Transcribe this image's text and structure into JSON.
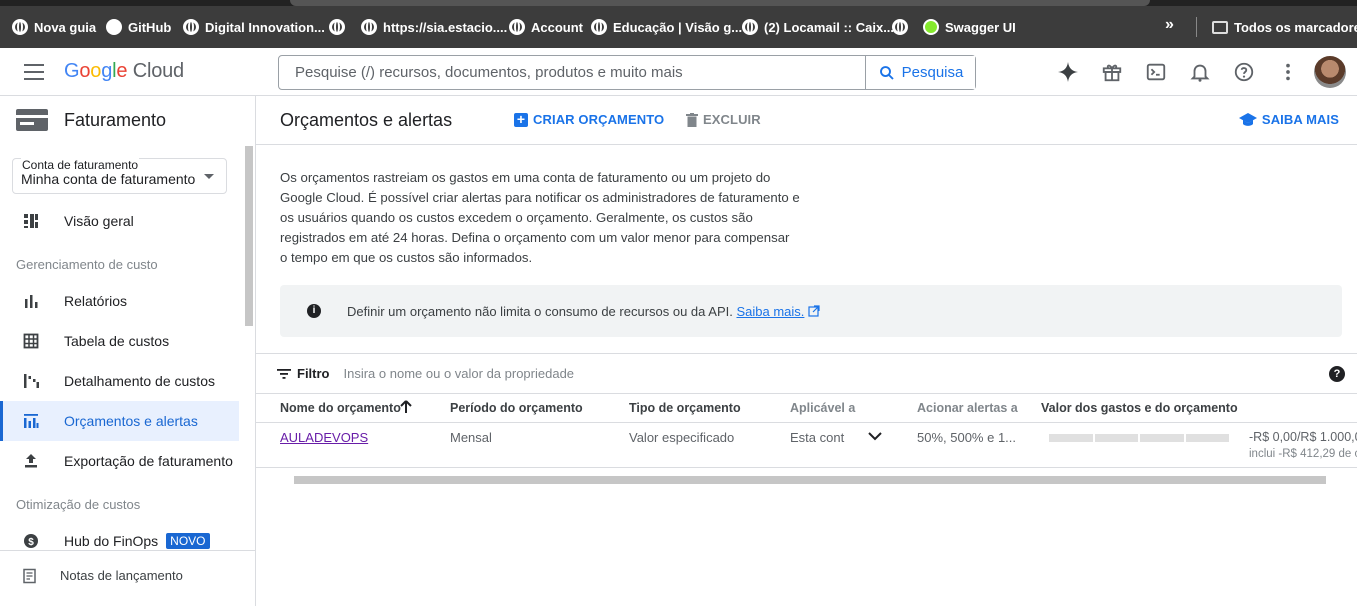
{
  "bookmarks": {
    "items": [
      {
        "label": "Nova guia",
        "icon": "globe-icon"
      },
      {
        "label": "GitHub",
        "icon": "github-icon"
      },
      {
        "label": "Digital Innovation...",
        "icon": "globe-icon"
      },
      {
        "label": "",
        "icon": "globe-icon"
      },
      {
        "label": "https://sia.estacio....",
        "icon": "globe-icon"
      },
      {
        "label": "Account",
        "icon": "globe-icon"
      },
      {
        "label": "Educação | Visão g...",
        "icon": "globe-icon"
      },
      {
        "label": "(2) Locamail :: Caix...",
        "icon": "globe-icon"
      },
      {
        "label": "",
        "icon": "globe-icon"
      },
      {
        "label": "Swagger UI",
        "icon": "swagger-icon"
      }
    ],
    "more": "»",
    "all_bookmarks": "Todos os marcadores"
  },
  "header": {
    "logo_parts": [
      "G",
      "o",
      "o",
      "g",
      "l",
      "e"
    ],
    "logo_cloud": "Cloud",
    "search_placeholder": "Pesquise (/) recursos, documentos, produtos e muito mais",
    "search_button": "Pesquisa"
  },
  "sidebar": {
    "title": "Faturamento",
    "account_label": "Conta de faturamento",
    "account_value": "Minha conta de faturamento",
    "items": {
      "overview": "Visão geral",
      "section_cost_mgmt": "Gerenciamento de custo",
      "reports": "Relatórios",
      "cost_table": "Tabela de custos",
      "cost_breakdown": "Detalhamento de custos",
      "budgets": "Orçamentos e alertas",
      "billing_export": "Exportação de faturamento",
      "section_cost_opt": "Otimização de custos",
      "finops_hub": "Hub do FinOps",
      "finops_badge": "NOVO"
    },
    "release_notes": "Notas de lançamento"
  },
  "main": {
    "title": "Orçamentos e alertas",
    "create_button": "CRIAR ORÇAMENTO",
    "delete_button": "EXCLUIR",
    "learn_more_button": "SAIBA MAIS",
    "description": "Os orçamentos rastreiam os gastos em uma conta de faturamento ou um projeto do Google Cloud. É possível criar alertas para notificar os administradores de faturamento e os usuários quando os custos excedem o orçamento. Geralmente, os custos são registrados em até 24 horas. Defina o orçamento com um valor menor para compensar o tempo em que os custos são informados.",
    "info_text": "Definir um orçamento não limita o consumo de recursos ou da API.",
    "info_link": "Saiba mais.",
    "filter_label": "Filtro",
    "filter_placeholder": "Insira o nome ou o valor da propriedade",
    "table": {
      "headers": [
        "Nome do orçamento",
        "Período do orçamento",
        "Tipo de orçamento",
        "Aplicável a",
        "Acionar alertas a",
        "Valor dos gastos e do orçamento"
      ],
      "rows": [
        {
          "name": "AULADEVOPS",
          "period": "Mensal",
          "type": "Valor especificado",
          "applies_to": "Esta cont",
          "alerts": "50%, 500% e 1...",
          "spend_fraction": 0,
          "amount": "-R$ 0,00/R$ 1.000,0",
          "amount_sub": "inclui -R$ 412,29 de c"
        }
      ]
    }
  },
  "colors": {
    "accent": "#1a73e8",
    "active_bg": "#e8f0fe",
    "link_visited": "#681da8"
  }
}
